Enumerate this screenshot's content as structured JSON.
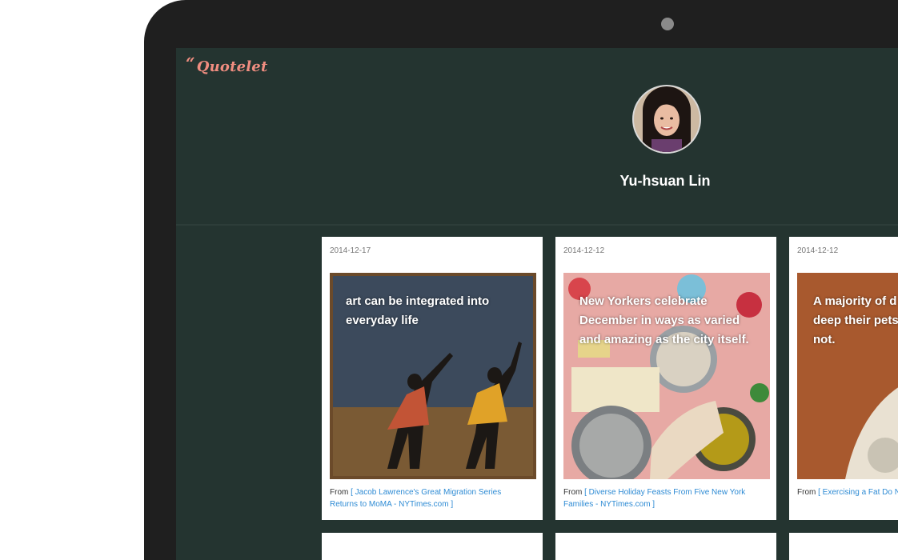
{
  "app": {
    "brand_mark": "“",
    "brand_name": "Quotelet"
  },
  "profile": {
    "name": "Yu-hsuan Lin"
  },
  "cards": [
    {
      "date": "2014-12-17",
      "quote": "art can be integrated into everyday life",
      "source_prefix": "From",
      "source_link": "[ Jacob Lawrence's Great Migration Series Returns to MoMA - NYTimes.com ]"
    },
    {
      "date": "2014-12-12",
      "quote": "New Yorkers celebrate December in ways as varied and amazing as the city itself.",
      "source_prefix": "From",
      "source_link": "[ Diverse Holiday Feasts From Five New York Families - NYTimes.com ]"
    },
    {
      "date": "2014-12-12",
      "quote": "A majority of d course,are deep their pets, whe them or not.",
      "source_prefix": "From",
      "source_link": "[ Exercising a Fat Do NYTimes.com ]"
    }
  ],
  "colors": {
    "screen_bg": "#243430",
    "brand": "#f08d80",
    "link": "#2e8bd4"
  }
}
